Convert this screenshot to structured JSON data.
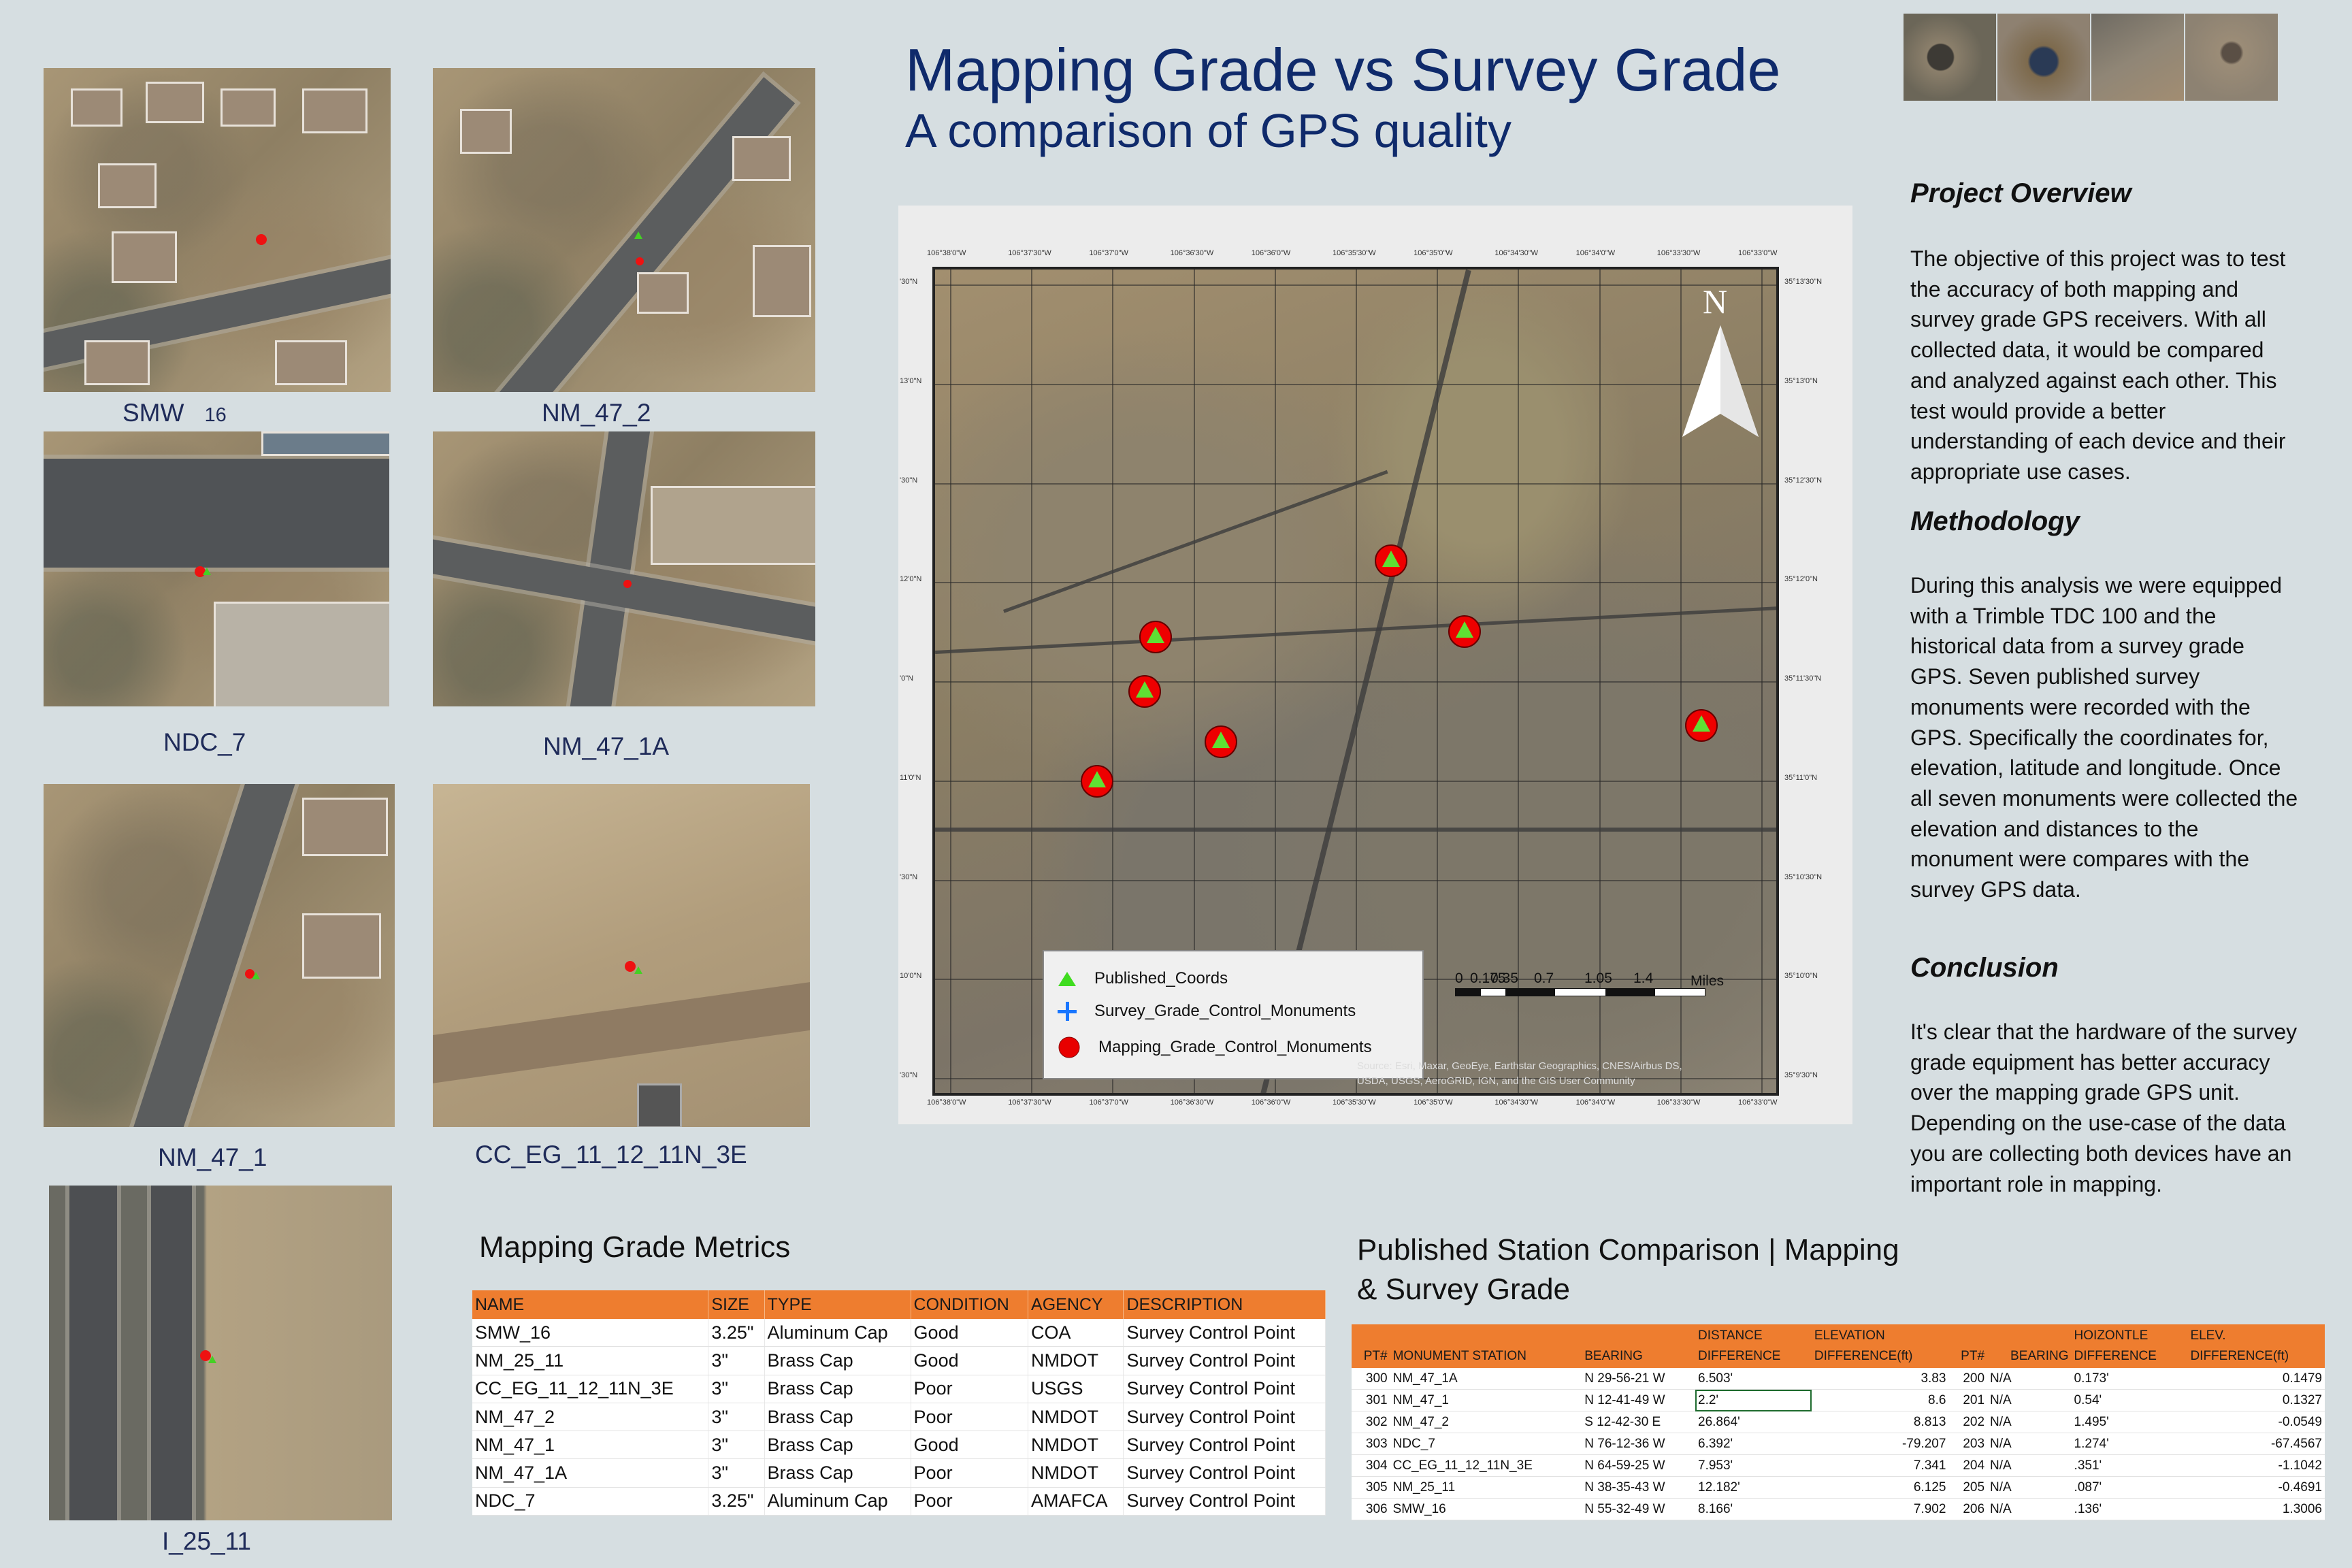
{
  "title": {
    "main": "Mapping Grade vs Survey Grade",
    "sub": "A comparison of GPS quality"
  },
  "thumbnails": [
    {
      "label": "SMW",
      "label_sub": "16"
    },
    {
      "label": "NM_47_2"
    },
    {
      "label": "NDC_7"
    },
    {
      "label": "NM_47_1A"
    },
    {
      "label": "NM_47_1"
    },
    {
      "label": "CC_EG_11_12_11N_3E"
    },
    {
      "label": "I_25_11"
    }
  ],
  "map": {
    "legend": [
      {
        "label": "Published_Coords",
        "icon": "green-triangle-icon"
      },
      {
        "label": "Survey_Grade_Control_Monuments",
        "icon": "blue-plus-icon"
      },
      {
        "label": "Mapping_Grade_Control_Monuments",
        "icon": "red-circle-icon"
      }
    ],
    "north_label": "N",
    "scale_labels": [
      "0",
      "0.175",
      "0.35",
      "0.7",
      "1.05",
      "1.4"
    ],
    "scale_unit": "Miles",
    "attribution": [
      "Source: Esri, Maxar, GeoEye, Earthstar Geographics, CNES/Airbus DS,",
      "USDA, USGS, AeroGRID, IGN, and the GIS User Community"
    ],
    "top_ticks": [
      "106°38'0\"W",
      "106°37'30\"W",
      "106°37'0\"W",
      "106°36'30\"W",
      "106°36'0\"W",
      "106°35'30\"W",
      "106°35'0\"W",
      "106°34'30\"W",
      "106°34'0\"W",
      "106°33'30\"W",
      "106°33'0\"W"
    ],
    "right_ticks": [
      "35°13'30\"N",
      "35°13'0\"N",
      "35°12'30\"N",
      "35°12'0\"N",
      "35°11'30\"N",
      "35°11'0\"N",
      "35°10'30\"N",
      "35°10'0\"N",
      "35°9'30\"N"
    ],
    "left_ticks": [
      "'30\"N",
      "13'0\"N",
      "'30\"N",
      "12'0\"N",
      "'0\"N",
      "11'0\"N",
      "'30\"N",
      "10'0\"N",
      "'30\"N"
    ]
  },
  "overview": {
    "heading": "Project Overview",
    "text": "The objective of this project was to test the accuracy of both mapping and survey grade GPS receivers. With all collected data, it would be compared and analyzed against each other. This test would provide a better understanding of each device and their appropriate use cases."
  },
  "methodology": {
    "heading": "Methodology",
    "text": "During this analysis we were equipped with a Trimble TDC 100 and the historical data from a survey grade GPS. Seven published survey monuments were recorded with the GPS. Specifically the coordinates for, elevation, latitude and longitude. Once all seven monuments were collected the elevation and distances to the monument were compares with the survey GPS data."
  },
  "conclusion": {
    "heading": "Conclusion",
    "text": "It's clear that the hardware of the survey grade equipment has better accuracy over the mapping grade GPS unit. Depending on the use-case of the data you are collecting both devices have an important role in mapping."
  },
  "metrics_table": {
    "title": "Mapping Grade Metrics",
    "headers": [
      "NAME",
      "SIZE",
      "TYPE",
      "CONDITION",
      "AGENCY",
      "DESCRIPTION"
    ],
    "rows": [
      [
        "SMW_16",
        "3.25\"",
        "Aluminum Cap",
        "Good",
        "COA",
        "Survey Control Point"
      ],
      [
        "NM_25_11",
        "3\"",
        "Brass Cap",
        "Good",
        "NMDOT",
        "Survey Control Point"
      ],
      [
        "CC_EG_11_12_11N_3E",
        "3\"",
        "Brass Cap",
        "Poor",
        "USGS",
        "Survey Control Point"
      ],
      [
        "NM_47_2",
        "3\"",
        "Brass Cap",
        "Poor",
        "NMDOT",
        "Survey Control Point"
      ],
      [
        "NM_47_1",
        "3\"",
        "Brass Cap",
        "Good",
        "NMDOT",
        "Survey Control Point"
      ],
      [
        "NM_47_1A",
        "3\"",
        "Brass Cap",
        "Poor",
        "NMDOT",
        "Survey Control Point"
      ],
      [
        "NDC_7",
        "3.25\"",
        "Aluminum Cap",
        "Poor",
        "AMAFCA",
        "Survey Control Point"
      ]
    ]
  },
  "comparison_table": {
    "title_line1": "Published Station Comparison | Mapping",
    "title_line2": "& Survey Grade",
    "headers": [
      [
        "",
        "PT#"
      ],
      [
        "",
        "MONUMENT STATION"
      ],
      [
        "",
        "BEARING"
      ],
      [
        "DISTANCE",
        "DIFFERENCE"
      ],
      [
        "ELEVATION",
        "DIFFERENCE(ft)"
      ],
      [
        "",
        "PT#"
      ],
      [
        "",
        "BEARING"
      ],
      [
        "HOIZONTLE",
        "DIFFERENCE"
      ],
      [
        "ELEV.",
        "DIFFERENCE(ft)"
      ]
    ],
    "rows": [
      [
        "300",
        "NM_47_1A",
        "N 29-56-21 W",
        "6.503'",
        "3.83",
        "200",
        "N/A",
        "0.173'",
        "0.1479"
      ],
      [
        "301",
        "NM_47_1",
        "N 12-41-49 W",
        "2.2'",
        "8.6",
        "201",
        "N/A",
        "0.54'",
        "0.1327"
      ],
      [
        "302",
        "NM_47_2",
        "S 12-42-30 E",
        "26.864'",
        "8.813",
        "202",
        "N/A",
        "1.495'",
        "-0.0549"
      ],
      [
        "303",
        "NDC_7",
        "N 76-12-36 W",
        "6.392'",
        "-79.207",
        "203",
        "N/A",
        "1.274'",
        "-67.4567"
      ],
      [
        "304",
        "CC_EG_11_12_11N_3E",
        "N 64-59-25 W",
        "7.953'",
        "7.341",
        "204",
        "N/A",
        ".351'",
        "-1.1042"
      ],
      [
        "305",
        "NM_25_11",
        "N 38-35-43 W",
        "12.182'",
        "6.125",
        "205",
        "N/A",
        ".087'",
        "-0.4691"
      ],
      [
        "306",
        "SMW_16",
        "N 55-32-49 W",
        "8.166'",
        "7.902",
        "206",
        "N/A",
        ".136'",
        "1.3006"
      ]
    ]
  },
  "colors": {
    "background": "#d6dee1",
    "title": "#0f2a6b",
    "table_header": "#ee7d2f"
  }
}
